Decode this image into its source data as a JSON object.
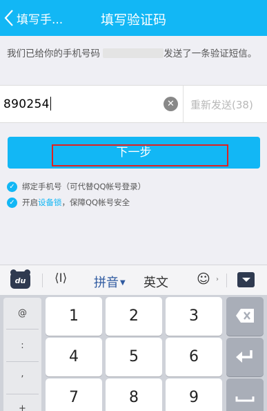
{
  "header": {
    "back_label": "填写手...",
    "title": "填写验证码"
  },
  "notice": {
    "prefix": "我们已给你的手机号码 ",
    "suffix": "发送了一条验证短信。"
  },
  "code": {
    "value": "890254",
    "resend_label": "重新发送(38)"
  },
  "next_button": {
    "label": "下一步"
  },
  "options": {
    "bind_phone": "绑定手机号（可代替QQ帐号登录）",
    "lock_prefix": "开启",
    "lock_link": "设备锁",
    "lock_suffix": "，保障QQ帐号安全"
  },
  "ime": {
    "logo": "du",
    "cursor_icon": "⟨I⟩",
    "pinyin": "拼音",
    "english": "英文",
    "emoji": "☺",
    "icons": [
      "baidu-ime-logo-icon",
      "cursor-move-icon",
      "emoji-icon",
      "hide-keyboard-icon",
      "backspace-icon",
      "enter-icon",
      "space-icon"
    ]
  },
  "keyboard": {
    "symbols": [
      "@",
      ":",
      ",",
      "+"
    ],
    "keys": [
      "1",
      "2",
      "3",
      "4",
      "5",
      "6",
      "7",
      "8",
      "9"
    ]
  },
  "colors": {
    "accent": "#12b7f5",
    "highlight": "#e02020"
  }
}
